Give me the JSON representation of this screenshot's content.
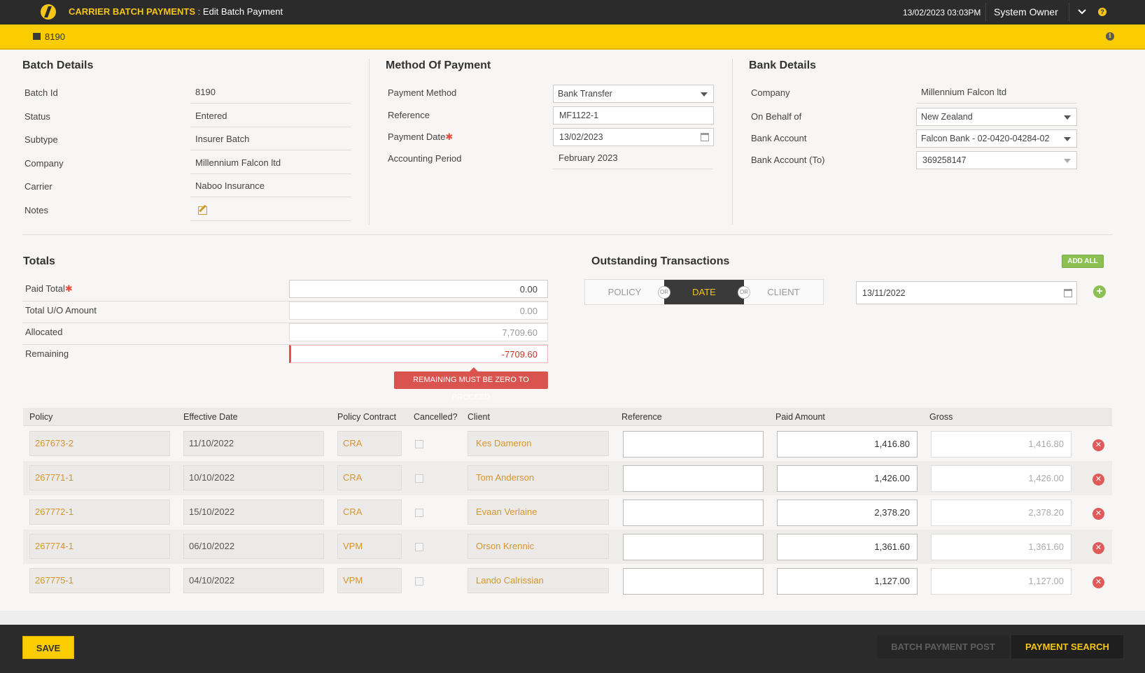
{
  "header": {
    "app_name": "CARRIER BATCH PAYMENTS",
    "page_name": " : Edit Batch Payment",
    "datetime": "13/02/2023 03:03PM",
    "user": "System Owner"
  },
  "subbar": {
    "batch_id": "8190"
  },
  "batch_details": {
    "title": "Batch Details",
    "fields": [
      {
        "label": "Batch Id",
        "value": "8190"
      },
      {
        "label": "Status",
        "value": "Entered"
      },
      {
        "label": "Subtype",
        "value": "Insurer Batch"
      },
      {
        "label": "Company",
        "value": "Millennium Falcon ltd"
      },
      {
        "label": "Carrier",
        "value": "Naboo Insurance"
      },
      {
        "label": "Notes",
        "value": ""
      }
    ]
  },
  "method_of_payment": {
    "title": "Method Of Payment",
    "payment_method_label": "Payment Method",
    "payment_method": "Bank Transfer",
    "reference_label": "Reference",
    "reference": "MF1122-1",
    "payment_date_label": "Payment Date",
    "payment_date": "13/02/2023",
    "accounting_period_label": "Accounting Period",
    "accounting_period": "February 2023"
  },
  "bank_details": {
    "title": "Bank Details",
    "company_label": "Company",
    "company": "Millennium Falcon ltd",
    "on_behalf_label": "On Behalf of",
    "on_behalf": "New Zealand",
    "bank_account_label": "Bank Account",
    "bank_account": "Falcon Bank - 02-0420-04284-02",
    "bank_account_to_label": "Bank Account (To)",
    "bank_account_to": "369258147"
  },
  "totals": {
    "title": "Totals",
    "paid_total_label": "Paid Total",
    "paid_total": "0.00",
    "total_uo_label": "Total U/O Amount",
    "total_uo": "0.00",
    "allocated_label": "Allocated",
    "allocated": "7,709.60",
    "remaining_label": "Remaining",
    "remaining": "-7709.60",
    "error": "REMAINING MUST BE ZERO TO PROCEED"
  },
  "outstanding": {
    "title": "Outstanding Transactions",
    "add_all": "ADD ALL",
    "tabs": [
      "POLICY",
      "DATE",
      "CLIENT"
    ],
    "or": "OR",
    "date": "13/11/2022"
  },
  "table": {
    "headers": [
      "Policy",
      "Effective Date",
      "Policy Contract",
      "Cancelled?",
      "Client",
      "Reference",
      "Paid Amount",
      "Gross"
    ],
    "rows": [
      {
        "policy": "267673-2",
        "effective": "11/10/2022",
        "contract": "CRA",
        "client": "Kes Dameron",
        "reference": "",
        "paid": "1,416.80",
        "gross": "1,416.80"
      },
      {
        "policy": "267771-1",
        "effective": "10/10/2022",
        "contract": "CRA",
        "client": "Tom Anderson",
        "reference": "",
        "paid": "1,426.00",
        "gross": "1,426.00"
      },
      {
        "policy": "267772-1",
        "effective": "15/10/2022",
        "contract": "CRA",
        "client": "Evaan Verlaine",
        "reference": "",
        "paid": "2,378.20",
        "gross": "2,378.20"
      },
      {
        "policy": "267774-1",
        "effective": "06/10/2022",
        "contract": "VPM",
        "client": "Orson Krennic",
        "reference": "",
        "paid": "1,361.60",
        "gross": "1,361.60"
      },
      {
        "policy": "267775-1",
        "effective": "04/10/2022",
        "contract": "VPM",
        "client": "Lando Calrissian",
        "reference": "",
        "paid": "1,127.00",
        "gross": "1,127.00"
      }
    ]
  },
  "footer": {
    "save": "SAVE",
    "batch_payment_post": "BATCH PAYMENT POST",
    "payment_search": "PAYMENT SEARCH"
  },
  "colors": {
    "accent": "#fbcd00",
    "dark": "#2b2b2b",
    "link": "#d7952a",
    "error": "#d9534f",
    "success": "#8cc152"
  }
}
